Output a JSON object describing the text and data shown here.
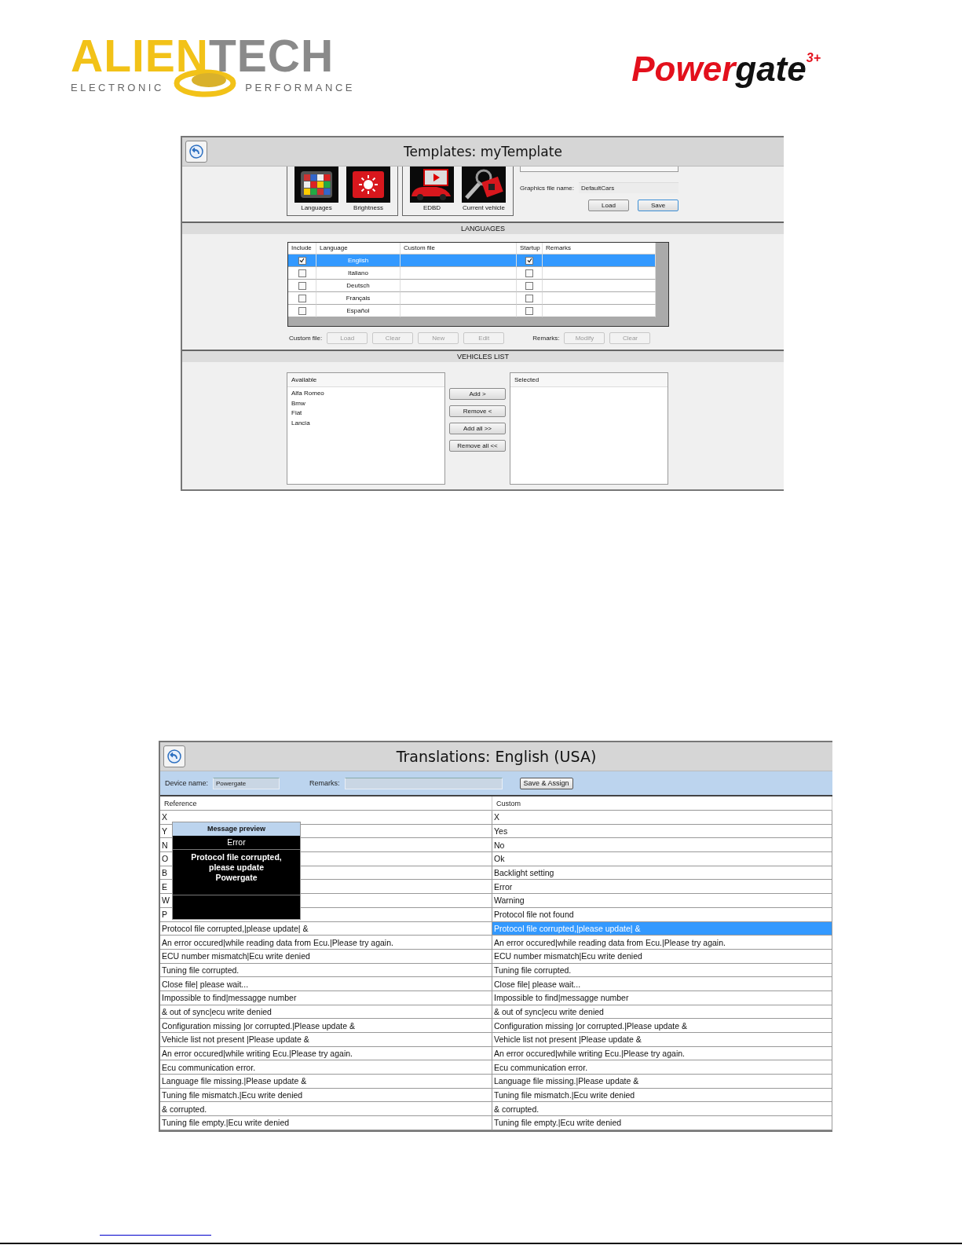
{
  "header": {
    "brand": {
      "part1": "ALIEN",
      "part2": "TECH",
      "left_tagline": "ELECTRONIC",
      "right_tagline": "PERFORMANCE"
    },
    "product": {
      "part1": "Power",
      "part2": "gate",
      "superscript": "3+"
    }
  },
  "templates_window": {
    "title": "Templates: myTemplate",
    "tool_groups": [
      [
        {
          "label": "Languages",
          "kind": "flags"
        },
        {
          "label": "Brightness",
          "kind": "sun"
        }
      ],
      [
        {
          "label": "EDBD",
          "kind": "car"
        },
        {
          "label": "Current vehicle",
          "kind": "key"
        }
      ]
    ],
    "graphics_file": {
      "label": "Graphics file name:",
      "value": "DefaultCars"
    },
    "file_buttons": [
      {
        "label": "Load",
        "default": false
      },
      {
        "label": "Save",
        "default": true
      }
    ],
    "languages": {
      "heading": "LANGUAGES",
      "columns": [
        "Include",
        "Language",
        "Custom file",
        "Startup",
        "Remarks"
      ],
      "rows": [
        {
          "include": true,
          "language": "English",
          "startup": true,
          "selected": true
        },
        {
          "include": false,
          "language": "Italiano",
          "startup": false,
          "selected": false
        },
        {
          "include": false,
          "language": "Deutsch",
          "startup": false,
          "selected": false
        },
        {
          "include": false,
          "language": "Français",
          "startup": false,
          "selected": false
        },
        {
          "include": false,
          "language": "Español",
          "startup": false,
          "selected": false
        }
      ]
    },
    "custom_file": {
      "label": "Custom file:",
      "buttons": [
        {
          "label": "Load",
          "disabled": true
        },
        {
          "label": "Clear",
          "disabled": true
        },
        {
          "label": "New",
          "disabled": true
        },
        {
          "label": "Edit",
          "disabled": true
        }
      ]
    },
    "remarks": {
      "label": "Remarks:",
      "buttons": [
        {
          "label": "Modify",
          "disabled": true
        },
        {
          "label": "Clear",
          "disabled": true
        }
      ]
    },
    "vehicles": {
      "heading": "VEHICLES LIST",
      "available": {
        "header": "Available",
        "items": [
          "Alfa Romeo",
          "Bmw",
          "Fiat",
          "Lancia"
        ]
      },
      "actions": [
        {
          "label": "Add >",
          "disabled": false
        },
        {
          "label": "Remove <",
          "disabled": false
        },
        {
          "label": "Add all >>",
          "disabled": false
        },
        {
          "label": "Remove all <<",
          "disabled": false
        }
      ],
      "selected_list": {
        "header": "Selected"
      }
    }
  },
  "translations_window": {
    "title": "Translations: English (USA)",
    "device_name": {
      "label": "Device name:",
      "value": "Powergate"
    },
    "remarks": {
      "label": "Remarks:"
    },
    "save_button": "Save & Assign",
    "columns": [
      "Reference",
      "Custom"
    ],
    "rows": [
      {
        "reference": "X",
        "custom": "X",
        "selected": false
      },
      {
        "reference": "Y",
        "custom": "Yes",
        "selected": false
      },
      {
        "reference": "N",
        "custom": "No",
        "selected": false
      },
      {
        "reference": "O",
        "custom": "Ok",
        "selected": false
      },
      {
        "reference": "B",
        "custom": "Backlight setting",
        "selected": false
      },
      {
        "reference": "E",
        "custom": "Error",
        "selected": false
      },
      {
        "reference": "W",
        "custom": "Warning",
        "selected": false
      },
      {
        "reference": "P",
        "custom": "Protocol file not found",
        "selected": false
      },
      {
        "reference": "Protocol file corrupted,|please update| &",
        "custom": "Protocol file corrupted,|please update| &",
        "selected": true
      },
      {
        "reference": "An error occured|while reading data from Ecu.|Please try again.",
        "custom": "An error occured|while reading data from Ecu.|Please try again.",
        "selected": false
      },
      {
        "reference": "ECU number mismatch|Ecu write denied",
        "custom": "ECU number mismatch|Ecu write denied",
        "selected": false
      },
      {
        "reference": "Tuning file corrupted.",
        "custom": "Tuning file corrupted.",
        "selected": false
      },
      {
        "reference": "Close file| please wait...",
        "custom": "Close file| please wait...",
        "selected": false
      },
      {
        "reference": "Impossible to find|messagge number",
        "custom": "Impossible to find|messagge number",
        "selected": false
      },
      {
        "reference": "& out of sync|ecu write denied",
        "custom": "& out of sync|ecu write denied",
        "selected": false
      },
      {
        "reference": "Configuration missing |or corrupted.|Please update &",
        "custom": "Configuration missing |or corrupted.|Please update &",
        "selected": false
      },
      {
        "reference": "Vehicle list not present |Please update &",
        "custom": "Vehicle list not present |Please update &",
        "selected": false
      },
      {
        "reference": "An error occured|while writing Ecu.|Please try again.",
        "custom": "An error occured|while writing Ecu.|Please try again.",
        "selected": false
      },
      {
        "reference": "Ecu communication error.",
        "custom": "Ecu communication error.",
        "selected": false
      },
      {
        "reference": "Language file missing.|Please update &",
        "custom": "Language file missing.|Please update &",
        "selected": false
      },
      {
        "reference": "Tuning file mismatch.|Ecu write denied",
        "custom": "Tuning file mismatch.|Ecu write denied",
        "selected": false
      },
      {
        "reference": "& corrupted.",
        "custom": "& corrupted.",
        "selected": false
      },
      {
        "reference": "Tuning file empty.|Ecu write denied",
        "custom": "Tuning file empty.|Ecu write denied",
        "selected": false
      }
    ],
    "preview": {
      "title": "Message preview",
      "heading": "Error",
      "message_lines": [
        "Protocol file corrupted,",
        "please update",
        "Powergate"
      ]
    }
  }
}
